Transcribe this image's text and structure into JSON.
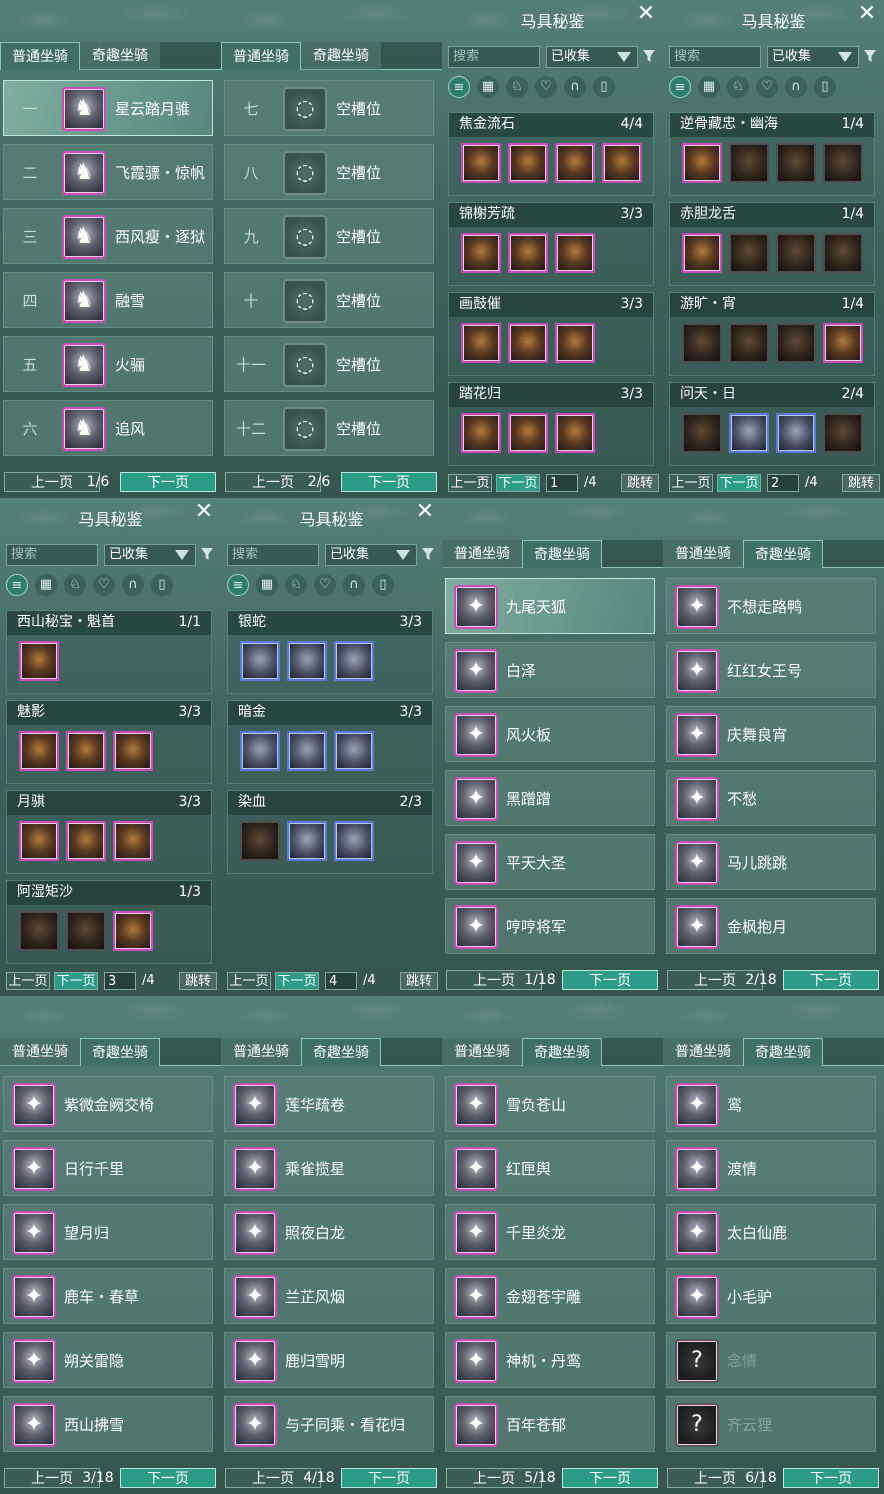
{
  "colors": {
    "accent": "#2c9c88",
    "rare_border": "#c74eb5",
    "blue_border": "#5e78d6",
    "panel": "#40645f"
  },
  "tabs": {
    "normal": "普通坐骑",
    "fun": "奇趣坐骑"
  },
  "pager": {
    "prev": "上一页",
    "next": "下一页"
  },
  "wardrobe": {
    "title": "马具秘鉴",
    "search_placeholder": "搜索",
    "filter_value": "已收集",
    "jump": "跳转",
    "total": "/4",
    "filter_icons": [
      "list-icon",
      "grid-icon",
      "horse-head-icon",
      "saddle-icon",
      "horseshoe-icon",
      "armor-icon"
    ]
  },
  "normal_pages": [
    {
      "page": "1/6",
      "rows": [
        {
          "num": "一",
          "name": "星云踏月骓",
          "icon": "white-horse-icon"
        },
        {
          "num": "二",
          "name": "飞霞骠・惊帆",
          "icon": "white-horse-icon"
        },
        {
          "num": "三",
          "name": "西风瘦・逐狱",
          "icon": "black-horse-icon"
        },
        {
          "num": "四",
          "name": "融雪",
          "icon": "red-horse-icon"
        },
        {
          "num": "五",
          "name": "火骊",
          "icon": "brown-horse-icon"
        },
        {
          "num": "六",
          "name": "追风",
          "icon": "blue-horse-icon"
        }
      ]
    },
    {
      "page": "2/6",
      "rows": [
        {
          "num": "七",
          "name": "空槽位",
          "icon": "empty-slot-icon"
        },
        {
          "num": "八",
          "name": "空槽位",
          "icon": "empty-slot-icon"
        },
        {
          "num": "九",
          "name": "空槽位",
          "icon": "empty-slot-icon"
        },
        {
          "num": "十",
          "name": "空槽位",
          "icon": "empty-slot-icon"
        },
        {
          "num": "十一",
          "name": "空槽位",
          "icon": "empty-slot-icon"
        },
        {
          "num": "十二",
          "name": "空槽位",
          "icon": "empty-slot-icon"
        }
      ]
    }
  ],
  "wardrobe_pages": [
    {
      "page": "1",
      "sets": [
        {
          "name": "焦金流石",
          "count": "4/4",
          "items": 4,
          "style": "rare"
        },
        {
          "name": "锦榭芳疏",
          "count": "3/3",
          "items": 3,
          "style": "rare"
        },
        {
          "name": "画鼓催",
          "count": "3/3",
          "items": 3,
          "style": "rare"
        },
        {
          "name": "踏花归",
          "count": "3/3",
          "items": 3,
          "style": "rare"
        }
      ]
    },
    {
      "page": "2",
      "sets": [
        {
          "name": "逆骨藏忠・幽海",
          "count": "1/4",
          "items": 4,
          "style": "mixed1"
        },
        {
          "name": "赤胆龙舌",
          "count": "1/4",
          "items": 4,
          "style": "mixed1"
        },
        {
          "name": "游旷・宵",
          "count": "1/4",
          "items": 4,
          "style": "mixed4"
        },
        {
          "name": "问天・日",
          "count": "2/4",
          "items": 4,
          "style": "mixed2"
        }
      ]
    },
    {
      "page": "3",
      "sets": [
        {
          "name": "西山秘宝・魁首",
          "count": "1/1",
          "items": 1,
          "style": "rare"
        },
        {
          "name": "魅影",
          "count": "3/3",
          "items": 3,
          "style": "rare"
        },
        {
          "name": "月骐",
          "count": "3/3",
          "items": 3,
          "style": "rare"
        },
        {
          "name": "阿湿矩沙",
          "count": "1/3",
          "items": 3,
          "style": "mixed3"
        }
      ]
    },
    {
      "page": "4",
      "sets": [
        {
          "name": "银蛇",
          "count": "3/3",
          "items": 3,
          "style": "blue"
        },
        {
          "name": "暗金",
          "count": "3/3",
          "items": 3,
          "style": "blue"
        },
        {
          "name": "染血",
          "count": "2/3",
          "items": 3,
          "style": "mixed2"
        }
      ]
    }
  ],
  "fun_pages": [
    {
      "page": "1/18",
      "rows": [
        {
          "name": "九尾天狐",
          "icon": "fox-icon"
        },
        {
          "name": "白泽",
          "icon": "white-beast-icon"
        },
        {
          "name": "风火板",
          "icon": "skateboard-icon"
        },
        {
          "name": "黑蹭蹭",
          "icon": "black-creature-icon"
        },
        {
          "name": "平天大圣",
          "icon": "bull-icon"
        },
        {
          "name": "哼哼将军",
          "icon": "pig-icon"
        }
      ]
    },
    {
      "page": "2/18",
      "rows": [
        {
          "name": "不想走路鸭",
          "icon": "duck-icon"
        },
        {
          "name": "红红女王号",
          "icon": "ship-icon"
        },
        {
          "name": "庆舞良宵",
          "icon": "lion-dance-icon"
        },
        {
          "name": "不愁",
          "icon": "pelican-icon"
        },
        {
          "name": "马儿跳跳",
          "icon": "donkey-icon"
        },
        {
          "name": "金枫抱月",
          "icon": "golden-ball-icon"
        }
      ]
    },
    {
      "page": "3/18",
      "rows": [
        {
          "name": "紫微金阙交椅",
          "icon": "throne-icon"
        },
        {
          "name": "日行千里",
          "icon": "monkey-icon"
        },
        {
          "name": "望月归",
          "icon": "deer-icon"
        },
        {
          "name": "鹿车・春草",
          "icon": "cart-icon"
        },
        {
          "name": "朔关雷隐",
          "icon": "white-horse-icon"
        },
        {
          "name": "西山拂雪",
          "icon": "white-deer-icon"
        }
      ]
    },
    {
      "page": "4/18",
      "rows": [
        {
          "name": "莲华疏卷",
          "icon": "white-dragon-icon"
        },
        {
          "name": "乘雀揽星",
          "icon": "lotus-icon"
        },
        {
          "name": "照夜白龙",
          "icon": "dragon-icon"
        },
        {
          "name": "兰芷风烟",
          "icon": "blue-beast-icon"
        },
        {
          "name": "鹿归雪明",
          "icon": "lion-icon"
        },
        {
          "name": "与子同乘・看花归",
          "icon": "twin-rider-icon"
        }
      ]
    },
    {
      "page": "5/18",
      "rows": [
        {
          "name": "雪负苍山",
          "icon": "yak-icon"
        },
        {
          "name": "红匣舆",
          "icon": "red-box-icon"
        },
        {
          "name": "千里炎龙",
          "icon": "fire-horse-icon"
        },
        {
          "name": "金翅苍宇雕",
          "icon": "eagle-icon"
        },
        {
          "name": "神机・丹鸾",
          "icon": "mech-bird-icon"
        },
        {
          "name": "百年苍郁",
          "icon": "turtle-icon"
        }
      ]
    },
    {
      "page": "6/18",
      "rows": [
        {
          "name": "鸾",
          "icon": "golden-bird-icon"
        },
        {
          "name": "渡情",
          "icon": "bamboo-raft-icon"
        },
        {
          "name": "太白仙鹿",
          "icon": "antler-icon"
        },
        {
          "name": "小毛驴",
          "icon": "donkey-icon"
        },
        {
          "name": "念情",
          "icon": "locked-mount-icon",
          "locked": true
        },
        {
          "name": "齐云狸",
          "icon": "locked-mount-icon",
          "locked": true
        }
      ]
    }
  ]
}
